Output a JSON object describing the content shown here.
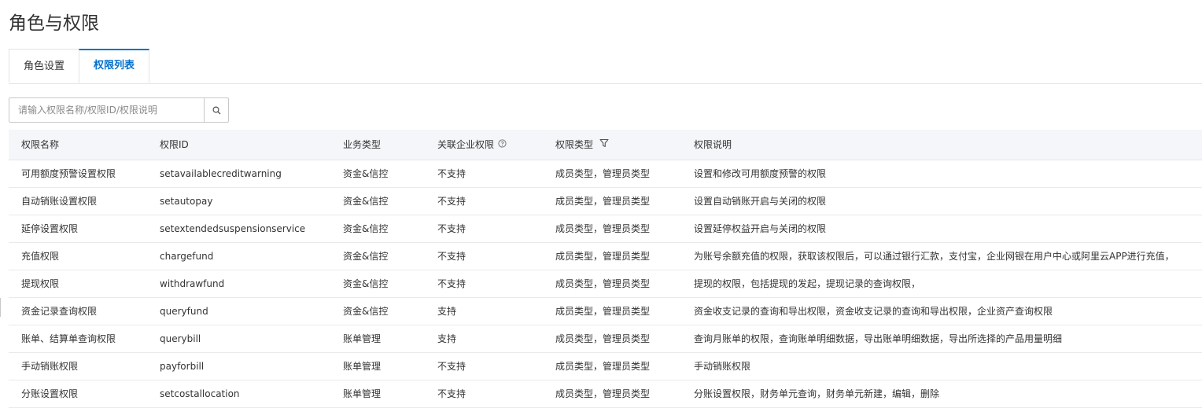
{
  "page": {
    "title": "角色与权限"
  },
  "tabs": [
    {
      "label": "角色设置",
      "active": false
    },
    {
      "label": "权限列表",
      "active": true
    }
  ],
  "search": {
    "placeholder": "请输入权限名称/权限ID/权限说明",
    "value": "",
    "button_icon": "search-icon"
  },
  "colors": {
    "accent": "#0070cc",
    "header_bg": "#f4f6f9",
    "border": "#e3e3e3"
  },
  "table": {
    "headers": [
      {
        "label": "权限名称"
      },
      {
        "label": "权限ID"
      },
      {
        "label": "业务类型"
      },
      {
        "label": "关联企业权限",
        "icon": "help-circle-icon"
      },
      {
        "label": "权限类型",
        "icon": "filter-icon"
      },
      {
        "label": "权限说明"
      }
    ],
    "rows": [
      [
        "可用额度预警设置权限",
        "setavailablecreditwarning",
        "资金&信控",
        "不支持",
        "成员类型，管理员类型",
        "设置和修改可用额度预警的权限"
      ],
      [
        "自动销账设置权限",
        "setautopay",
        "资金&信控",
        "不支持",
        "成员类型，管理员类型",
        "设置自动销账开启与关闭的权限"
      ],
      [
        "延停设置权限",
        "setextendedsuspensionservice",
        "资金&信控",
        "不支持",
        "成员类型，管理员类型",
        "设置延停权益开启与关闭的权限"
      ],
      [
        "充值权限",
        "chargefund",
        "资金&信控",
        "不支持",
        "成员类型，管理员类型",
        "为账号余额充值的权限，获取该权限后，可以通过银行汇款，支付宝，企业网银在用户中心或阿里云APP进行充值，"
      ],
      [
        "提现权限",
        "withdrawfund",
        "资金&信控",
        "不支持",
        "成员类型，管理员类型",
        "提现的权限，包括提现的发起，提现记录的查询权限，"
      ],
      [
        "资金记录查询权限",
        "queryfund",
        "资金&信控",
        "支持",
        "成员类型，管理员类型",
        "资金收支记录的查询和导出权限，资金收支记录的查询和导出权限，企业资产查询权限"
      ],
      [
        "账单、结算单查询权限",
        "querybill",
        "账单管理",
        "支持",
        "成员类型，管理员类型",
        "查询月账单的权限，查询账单明细数据，导出账单明细数据，导出所选择的产品用量明细"
      ],
      [
        "手动销账权限",
        "payforbill",
        "账单管理",
        "不支持",
        "成员类型，管理员类型",
        "手动销账权限"
      ],
      [
        "分账设置权限",
        "setcostallocation",
        "账单管理",
        "不支持",
        "成员类型，管理员类型",
        "分账设置权限，财务单元查询，财务单元新建，编辑，删除"
      ]
    ]
  }
}
